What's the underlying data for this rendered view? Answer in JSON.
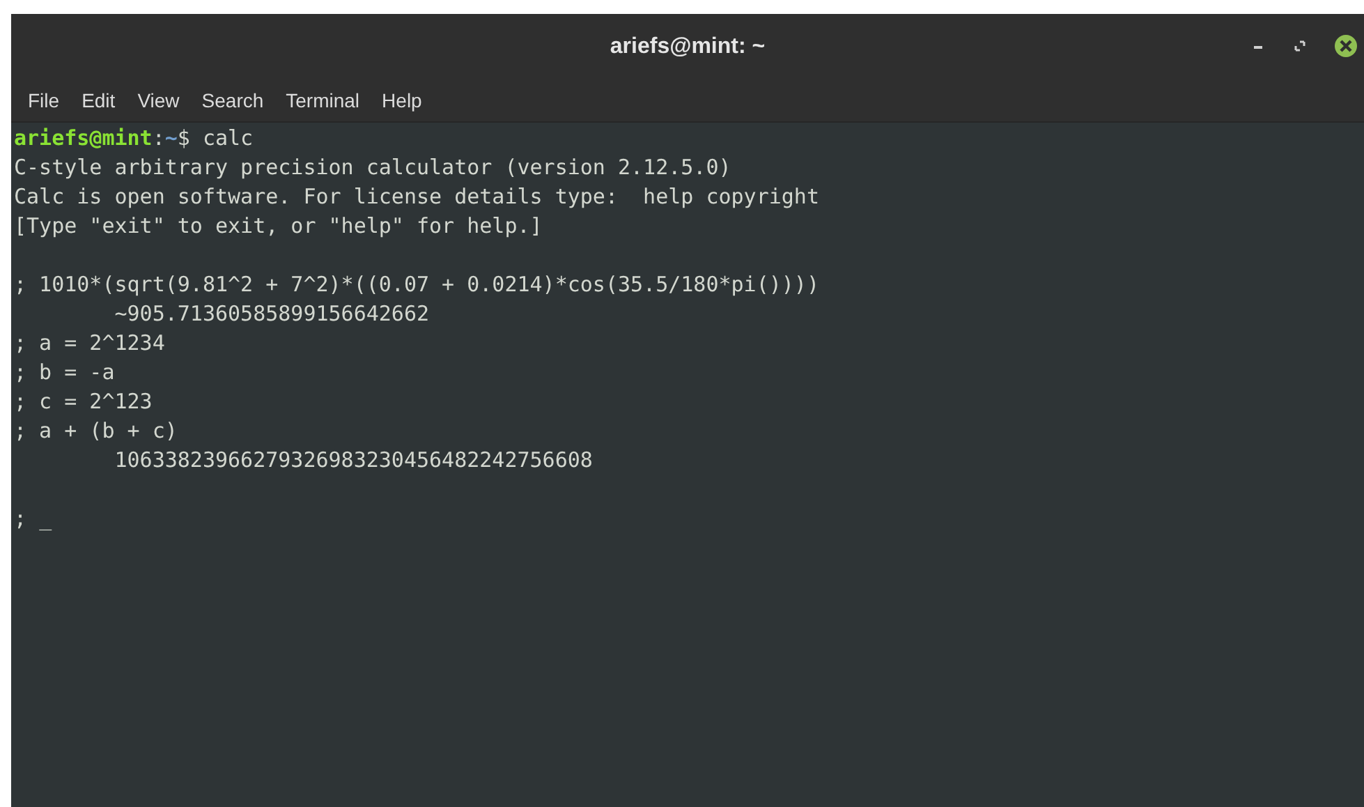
{
  "window": {
    "title": "ariefs@mint: ~"
  },
  "menu": [
    "File",
    "Edit",
    "View",
    "Search",
    "Terminal",
    "Help"
  ],
  "terminal": {
    "lines": [
      {
        "kind": "prompt",
        "user_host": "ariefs@mint",
        "separator": ":",
        "path": "~",
        "command": "$ calc"
      },
      {
        "kind": "text",
        "text": "C-style arbitrary precision calculator (version 2.12.5.0)"
      },
      {
        "kind": "text",
        "text": "Calc is open software. For license details type:  help copyright"
      },
      {
        "kind": "text",
        "text": "[Type \"exit\" to exit, or \"help\" for help.]"
      },
      {
        "kind": "blank"
      },
      {
        "kind": "text",
        "text": "; 1010*(sqrt(9.81^2 + 7^2)*((0.07 + 0.0214)*cos(35.5/180*pi())))"
      },
      {
        "kind": "text",
        "text": "\t~905.71360585899156642662"
      },
      {
        "kind": "text",
        "text": "; a = 2^1234"
      },
      {
        "kind": "text",
        "text": "; b = -a"
      },
      {
        "kind": "text",
        "text": "; c = 2^123"
      },
      {
        "kind": "text",
        "text": "; a + (b + c)"
      },
      {
        "kind": "text",
        "text": "\t10633823966279326983230456482242756608"
      },
      {
        "kind": "blank"
      },
      {
        "kind": "cursor",
        "text": "; ",
        "cursor": "_"
      }
    ]
  }
}
